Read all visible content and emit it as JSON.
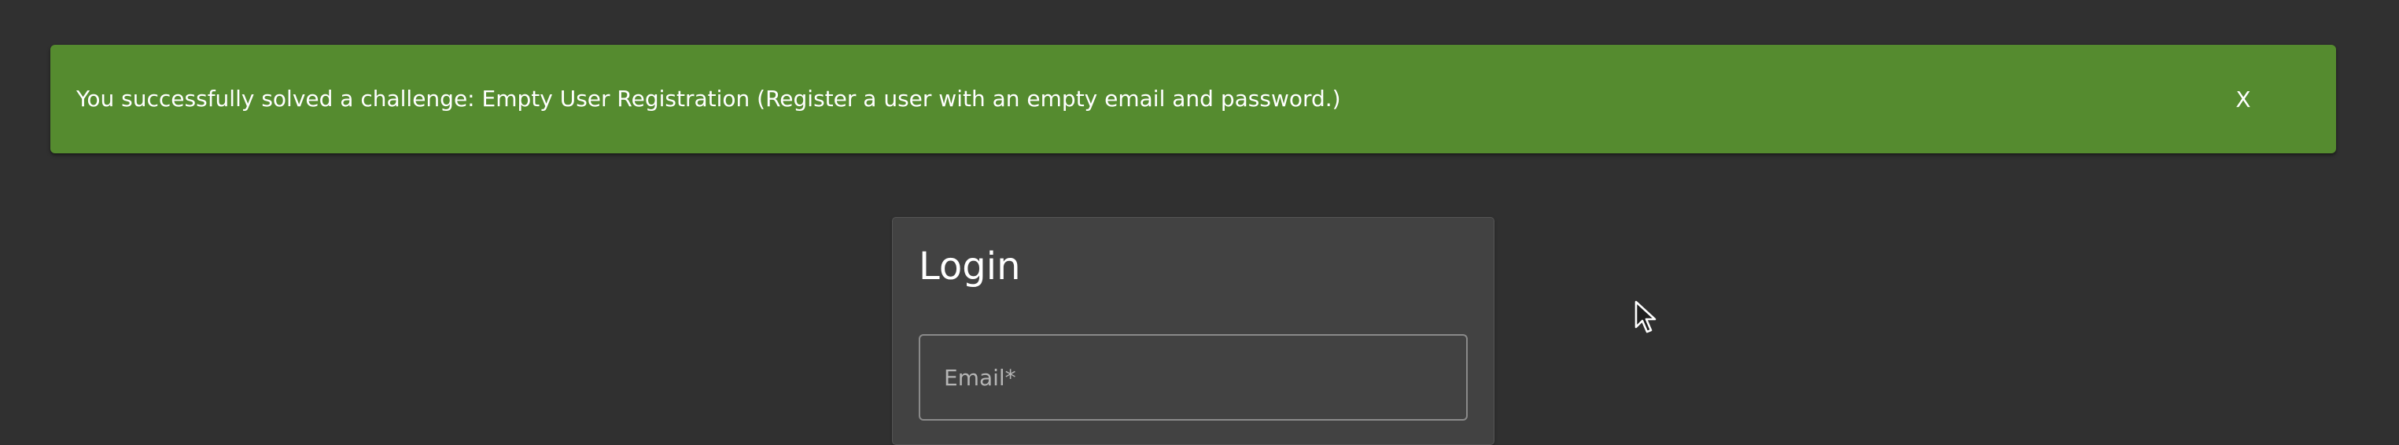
{
  "snackbar": {
    "message": "You successfully solved a challenge: Empty User Registration (Register a user with an empty email and password.)",
    "close_label": "X",
    "background_color": "#558b2f"
  },
  "login": {
    "title": "Login",
    "email_placeholder": "Email*",
    "email_value": ""
  },
  "theme": {
    "page_background": "#303030",
    "card_background": "#424242"
  },
  "icons": {
    "mouse_cursor": "cursor-pointer-icon"
  }
}
